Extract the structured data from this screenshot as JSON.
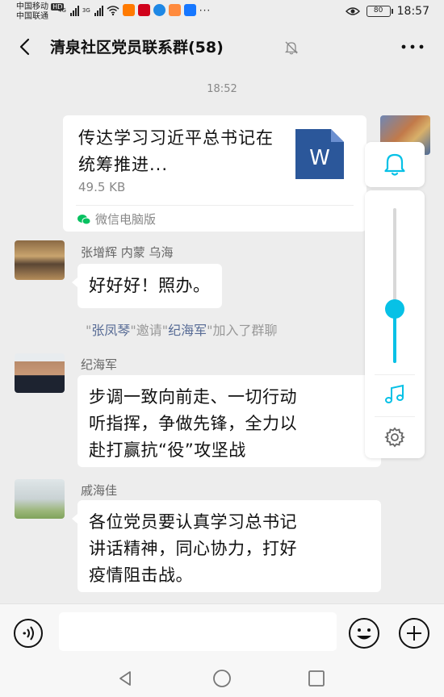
{
  "status_bar": {
    "carrier_1": "中国移动",
    "carrier_1_badge": "HD",
    "carrier_2": "中国联通",
    "signal_1_label": "4G",
    "signal_2_label": "3G",
    "battery": "80",
    "time": "18:57",
    "app_icons": [
      "taobao-icon",
      "netease-icon",
      "browser-icon",
      "store-icon",
      "alipay-icon",
      "more-dots-icon"
    ]
  },
  "header": {
    "title": "清泉社区党员联系群(58)",
    "back_icon": "chevron-left-icon",
    "mute_icon": "bell-off-icon",
    "more_icon": "more-horizontal-icon"
  },
  "chat": {
    "time_label": "18:52",
    "file_message": {
      "title": "传达学习习近平总书记在统筹推进...",
      "size": "49.5 KB",
      "file_icon_letter": "W",
      "source": "微信电脑版"
    },
    "messages": [
      {
        "sender": "张增辉  内蒙  乌海",
        "text": "好好好！照办。"
      },
      {
        "sender": "纪海军",
        "lines": [
          "步调一致向前走、一切行动",
          "听指挥，争做先锋，全力以",
          "赴打赢抗“役”攻坚战"
        ]
      },
      {
        "sender": "戚海佳",
        "lines": [
          "各位党员要认真学习总书记",
          "讲话精神，同心协力，打好",
          "疫情阻击战。"
        ]
      }
    ],
    "system_notice": {
      "q1": "\"",
      "inviter": "张凤琴",
      "mid": "\"邀请\"",
      "invitee": "纪海军",
      "tail": "\"加入了群聊"
    }
  },
  "floating_panel": {
    "bell_icon": "bell-icon",
    "volume_level": 0.35,
    "music_icon": "music-note-icon",
    "settings_icon": "gear-icon"
  },
  "input_bar": {
    "voice_icon": "voice-icon",
    "input_value": "",
    "emoji_icon": "emoji-icon",
    "plus_icon": "plus-icon"
  },
  "nav_bar": {
    "icons": [
      "back-triangle-icon",
      "home-circle-icon",
      "recents-square-icon"
    ]
  },
  "colors": {
    "background": "#ededed",
    "bubble": "#ffffff",
    "link_name": "#576b95",
    "volume_accent": "#07c1e6",
    "word_blue": "#2b579a",
    "wechat_green": "#07c160"
  }
}
